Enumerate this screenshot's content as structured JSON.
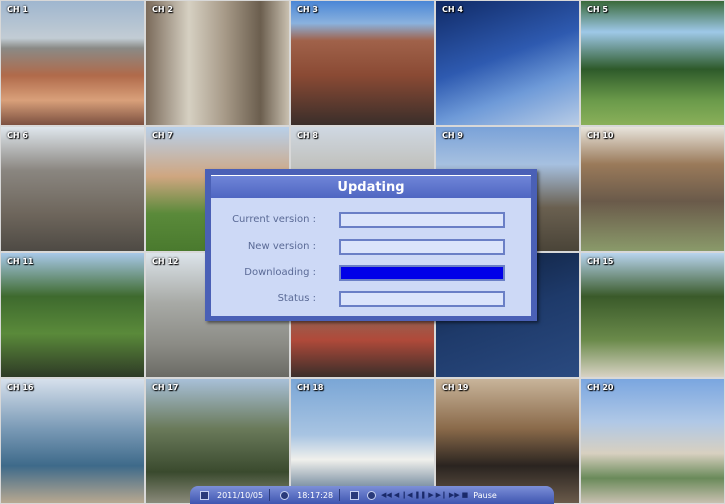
{
  "channels": [
    {
      "label": "CH 1"
    },
    {
      "label": "CH 2"
    },
    {
      "label": "CH 3"
    },
    {
      "label": "CH 4"
    },
    {
      "label": "CH 5"
    },
    {
      "label": "CH 6"
    },
    {
      "label": "CH 7"
    },
    {
      "label": "CH 8"
    },
    {
      "label": "CH 9"
    },
    {
      "label": "CH 10"
    },
    {
      "label": "CH 11"
    },
    {
      "label": "CH 12"
    },
    {
      "label": ""
    },
    {
      "label": ""
    },
    {
      "label": "CH 15"
    },
    {
      "label": "CH 16"
    },
    {
      "label": "CH 17"
    },
    {
      "label": "CH 18"
    },
    {
      "label": "CH 19"
    },
    {
      "label": "CH 20"
    }
  ],
  "dialog": {
    "title": "Updating",
    "current_version_label": "Current version :",
    "new_version_label": "New version :",
    "downloading_label": "Downloading :",
    "status_label": "Status :",
    "downloading_progress": 1.0,
    "progress_color": "#0000e8"
  },
  "playbar": {
    "date": "2011/10/05",
    "time": "18:17:28",
    "mode": "Pause",
    "controls": [
      "rewind-fast",
      "rewind",
      "step-back",
      "pause",
      "play",
      "step-forward",
      "forward-fast"
    ],
    "accent": "#4a60b6"
  }
}
